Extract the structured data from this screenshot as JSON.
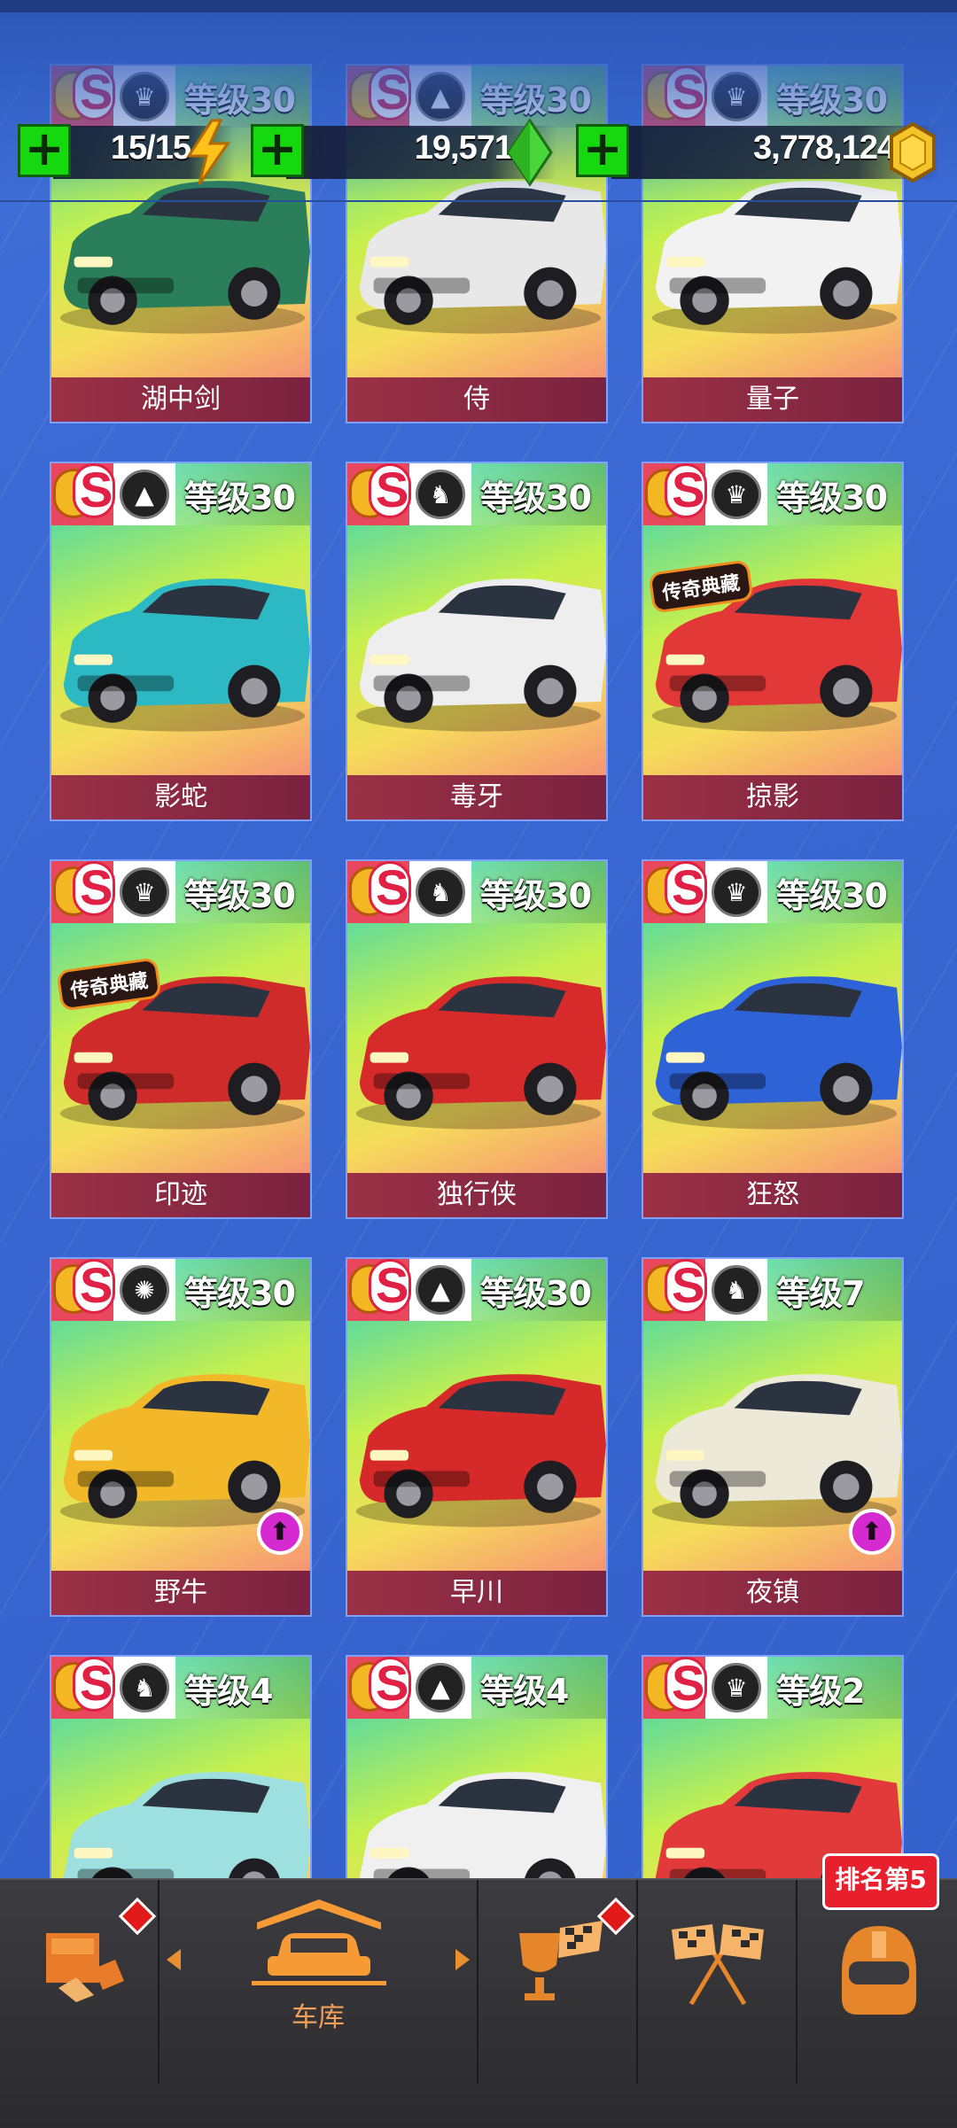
{
  "hud": {
    "energy": {
      "value": "15/15",
      "plus": "+",
      "icon": "lightning-icon"
    },
    "gems": {
      "value": "19,571",
      "plus": "+",
      "icon": "gem-icon"
    },
    "coins": {
      "value": "3,778,124",
      "plus": "+",
      "icon": "coin-icon"
    }
  },
  "cars": [
    {
      "name": "湖中剑",
      "grade": "等级30",
      "emblem": "crown-icon",
      "color": "#2a7f5a"
    },
    {
      "name": "侍",
      "grade": "等级30",
      "emblem": "road-icon",
      "color": "#e8e8e8"
    },
    {
      "name": "量子",
      "grade": "等级30",
      "emblem": "crown-icon",
      "color": "#f2f2f2"
    },
    {
      "name": "影蛇",
      "grade": "等级30",
      "emblem": "road-icon",
      "color": "#2db9c3"
    },
    {
      "name": "毒牙",
      "grade": "等级30",
      "emblem": "horse-icon",
      "color": "#eeeeee"
    },
    {
      "name": "掠影",
      "grade": "等级30",
      "emblem": "crown-icon",
      "color": "#e33838",
      "badge": "传奇典藏"
    },
    {
      "name": "印迹",
      "grade": "等级30",
      "emblem": "crown-icon",
      "color": "#cf2b2b",
      "badge": "传奇典藏"
    },
    {
      "name": "独行侠",
      "grade": "等级30",
      "emblem": "horse-icon",
      "color": "#d72a2a"
    },
    {
      "name": "狂怒",
      "grade": "等级30",
      "emblem": "crown-icon",
      "color": "#2e63d8"
    },
    {
      "name": "野牛",
      "grade": "等级30",
      "emblem": "wheel-icon",
      "color": "#f2b82a",
      "upgrade": true
    },
    {
      "name": "早川",
      "grade": "等级30",
      "emblem": "road-icon",
      "color": "#d62a2a"
    },
    {
      "name": "夜镇",
      "grade": "等级7",
      "emblem": "horse-icon",
      "color": "#ece9d9",
      "upgrade": true
    },
    {
      "name": "",
      "grade": "等级4",
      "emblem": "horse-icon",
      "color": "#9ee0e0"
    },
    {
      "name": "",
      "grade": "等级4",
      "emblem": "road-icon",
      "color": "#f0f0f0"
    },
    {
      "name": "",
      "grade": "等级2",
      "emblem": "crown-icon",
      "color": "#e23a3a"
    }
  ],
  "nav": {
    "garage_label": "车库",
    "rank_badge": "排名第5",
    "items": [
      "shop-icon",
      "garage-icon",
      "trophy-icon",
      "race-flags-icon",
      "helmet-icon"
    ]
  }
}
